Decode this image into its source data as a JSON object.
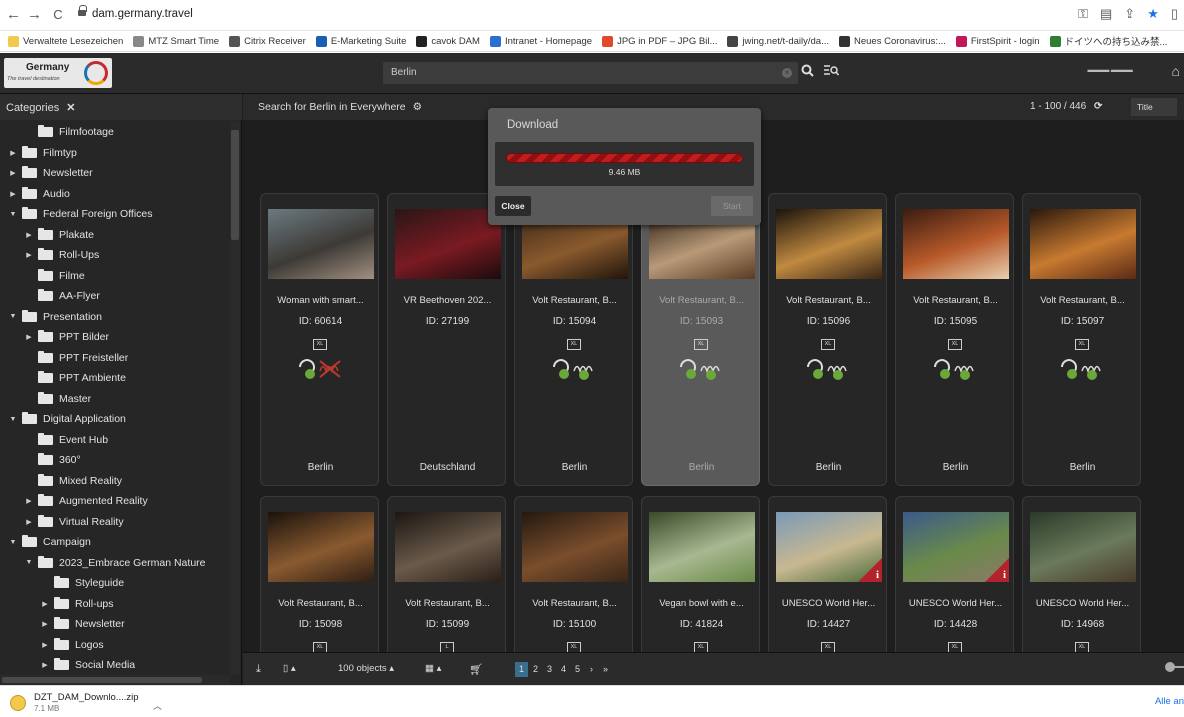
{
  "browser": {
    "url": "dam.germany.travel",
    "back": "←",
    "forward": "→",
    "reload": "C"
  },
  "bookmarks": [
    {
      "label": "Verwaltete Lesezeichen",
      "color": "#f2c94c"
    },
    {
      "label": "MTZ Smart Time",
      "color": "#888888"
    },
    {
      "label": "Citrix Receiver",
      "color": "#555555"
    },
    {
      "label": "E-Marketing Suite",
      "color": "#1a5fb4"
    },
    {
      "label": "cavok DAM",
      "color": "#222222"
    },
    {
      "label": "Intranet - Homepage",
      "color": "#2a6fd0"
    },
    {
      "label": "JPG in PDF – JPG Bil...",
      "color": "#e0492d"
    },
    {
      "label": "jwing.net/t-daily/da...",
      "color": "#444444"
    },
    {
      "label": "Neues Coronavirus:...",
      "color": "#333333"
    },
    {
      "label": "FirstSpirit - login",
      "color": "#c2185b"
    },
    {
      "label": "ドイツへの持ち込み禁...",
      "color": "#2e7d32"
    }
  ],
  "header": {
    "logo_title": "Germany",
    "logo_subtitle": "The travel destination",
    "search_value": "Berlin"
  },
  "sidebar": {
    "title": "Categories",
    "items": [
      {
        "label": "Filmfootage",
        "level": 1,
        "arrow": ""
      },
      {
        "label": "Filmtyp",
        "level": 0,
        "arrow": "▶"
      },
      {
        "label": "Newsletter",
        "level": 0,
        "arrow": "▶"
      },
      {
        "label": "Audio",
        "level": 0,
        "arrow": "▶"
      },
      {
        "label": "Federal Foreign Offices",
        "level": 0,
        "arrow": "▼"
      },
      {
        "label": "Plakate",
        "level": 1,
        "arrow": "▶"
      },
      {
        "label": "Roll-Ups",
        "level": 1,
        "arrow": "▶"
      },
      {
        "label": "Filme",
        "level": 1,
        "arrow": ""
      },
      {
        "label": "AA-Flyer",
        "level": 1,
        "arrow": ""
      },
      {
        "label": "Presentation",
        "level": 0,
        "arrow": "▼"
      },
      {
        "label": "PPT Bilder",
        "level": 1,
        "arrow": "▶"
      },
      {
        "label": "PPT Freisteller",
        "level": 1,
        "arrow": ""
      },
      {
        "label": "PPT Ambiente",
        "level": 1,
        "arrow": ""
      },
      {
        "label": "Master",
        "level": 1,
        "arrow": ""
      },
      {
        "label": "Digital Application",
        "level": 0,
        "arrow": "▼"
      },
      {
        "label": "Event Hub",
        "level": 1,
        "arrow": ""
      },
      {
        "label": "360°",
        "level": 1,
        "arrow": ""
      },
      {
        "label": "Mixed Reality",
        "level": 1,
        "arrow": ""
      },
      {
        "label": "Augmented Reality",
        "level": 1,
        "arrow": "▶"
      },
      {
        "label": "Virtual Reality",
        "level": 1,
        "arrow": "▶"
      },
      {
        "label": "Campaign",
        "level": 0,
        "arrow": "▼"
      },
      {
        "label": "2023_Embrace German Nature",
        "level": 1,
        "arrow": "▼"
      },
      {
        "label": "Styleguide",
        "level": 2,
        "arrow": ""
      },
      {
        "label": "Roll-ups",
        "level": 2,
        "arrow": "▶"
      },
      {
        "label": "Newsletter",
        "level": 2,
        "arrow": "▶"
      },
      {
        "label": "Logos",
        "level": 2,
        "arrow": "▶"
      },
      {
        "label": "Social Media",
        "level": 2,
        "arrow": "▶"
      }
    ]
  },
  "results": {
    "title": "Search for Berlin in Everywhere",
    "count": "1 - 100 / 446",
    "sort": "Title"
  },
  "cards": [
    {
      "title": "Woman with smart...",
      "id": "ID: 60614",
      "size": "XL",
      "location": "Berlin",
      "restricted": true,
      "info": false,
      "colors": [
        "#6b7a80",
        "#3d3a36",
        "#a29080"
      ]
    },
    {
      "title": "VR Beethoven 202...",
      "id": "ID: 27199",
      "size": "",
      "location": "Deutschland",
      "restricted": false,
      "info": false,
      "colors": [
        "#2a1616",
        "#7a1a22",
        "#1a0c0c"
      ]
    },
    {
      "title": "Volt Restaurant, B...",
      "id": "ID: 15094",
      "size": "XL",
      "location": "Berlin",
      "restricted": false,
      "info": false,
      "colors": [
        "#3b2618",
        "#8a5a2e",
        "#20140c"
      ]
    },
    {
      "title": "Volt Restaurant, B...",
      "id": "ID: 15093",
      "size": "XL",
      "location": "Berlin",
      "restricted": false,
      "info": false,
      "selected": true,
      "colors": [
        "#2a1c14",
        "#b89a78",
        "#5a3a22"
      ]
    },
    {
      "title": "Volt Restaurant, B...",
      "id": "ID: 15096",
      "size": "XL",
      "location": "Berlin",
      "restricted": false,
      "info": false,
      "colors": [
        "#1c130c",
        "#c08a40",
        "#3a2616"
      ]
    },
    {
      "title": "Volt Restaurant, B...",
      "id": "ID: 15095",
      "size": "XL",
      "location": "Berlin",
      "restricted": false,
      "info": false,
      "colors": [
        "#3a1c10",
        "#b85a2a",
        "#e8d0b0"
      ]
    },
    {
      "title": "Volt Restaurant, B...",
      "id": "ID: 15097",
      "size": "XL",
      "location": "Berlin",
      "restricted": false,
      "info": false,
      "colors": [
        "#2a180c",
        "#c87a30",
        "#5a2a14"
      ]
    },
    {
      "title": "Volt Restaurant, B...",
      "id": "ID: 15098",
      "size": "XL",
      "location": "",
      "restricted": false,
      "info": false,
      "colors": [
        "#1a120c",
        "#8a5a30",
        "#2e1e12"
      ]
    },
    {
      "title": "Volt Restaurant, B...",
      "id": "ID: 15099",
      "size": "L",
      "location": "",
      "restricted": false,
      "info": false,
      "colors": [
        "#1c1612",
        "#6a5a4a",
        "#2a2018"
      ]
    },
    {
      "title": "Volt Restaurant, B...",
      "id": "ID: 15100",
      "size": "XL",
      "location": "",
      "restricted": false,
      "info": false,
      "colors": [
        "#241810",
        "#7a4e2c",
        "#3a2618"
      ]
    },
    {
      "title": "Vegan bowl with e...",
      "id": "ID: 41824",
      "size": "XL",
      "location": "",
      "restricted": true,
      "info": false,
      "colors": [
        "#3a4a2a",
        "#a8b890",
        "#6a8a4a"
      ]
    },
    {
      "title": "UNESCO World Her...",
      "id": "ID: 14427",
      "size": "XL",
      "location": "",
      "restricted": false,
      "info": true,
      "colors": [
        "#7a9ab8",
        "#c8b890",
        "#4a6a3a"
      ]
    },
    {
      "title": "UNESCO World Her...",
      "id": "ID: 14428",
      "size": "XL",
      "location": "",
      "restricted": false,
      "info": true,
      "colors": [
        "#3a5a8a",
        "#6a8a4a",
        "#8a7a6a"
      ]
    },
    {
      "title": "UNESCO World Her...",
      "id": "ID: 14968",
      "size": "XL",
      "location": "",
      "restricted": false,
      "info": false,
      "colors": [
        "#2a3a2a",
        "#6a7a5a",
        "#4a3a2a"
      ]
    }
  ],
  "bottom": {
    "objects": "100 objects",
    "pages": [
      "1",
      "2",
      "3",
      "4",
      "5",
      "›",
      "»"
    ]
  },
  "dialog": {
    "title": "Download",
    "size": "9.46 MB",
    "progress": 1.0,
    "close_label": "Close",
    "start_label": "Start"
  },
  "download_bar": {
    "file": "DZT_DAM_Downlo....zip",
    "size": "7.1 MB",
    "show_all": "Alle an"
  }
}
